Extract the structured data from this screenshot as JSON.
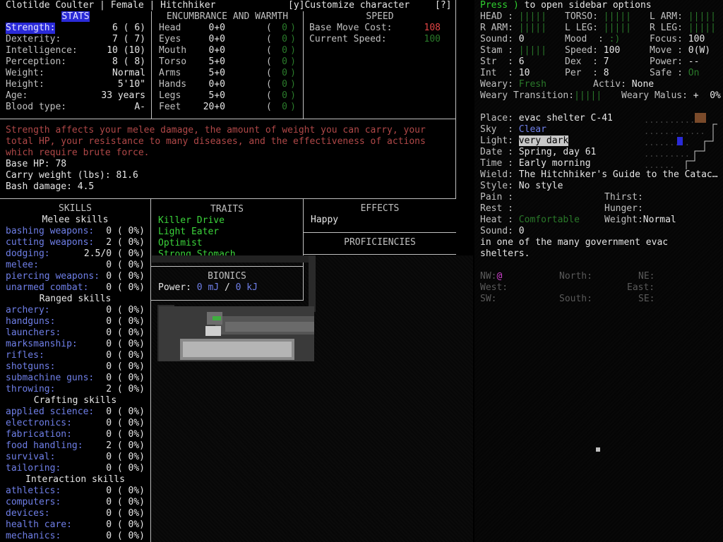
{
  "header": {
    "name_line": "Clotilde Coulter | Female | Hitchhiker",
    "customize": "[y]Customize character",
    "help": "[?]"
  },
  "stats": {
    "title": "STATS",
    "rows": [
      {
        "label": "Strength:",
        "value": "6 ( 6)"
      },
      {
        "label": "Dexterity:",
        "value": "7 ( 7)"
      },
      {
        "label": "Intelligence:",
        "value": "10 (10)"
      },
      {
        "label": "Perception:",
        "value": "8 ( 8)"
      },
      {
        "label": "Weight:",
        "value": "Normal"
      },
      {
        "label": "Height:",
        "value": "5'10\""
      },
      {
        "label": "Age:",
        "value": "33 years"
      },
      {
        "label": "Blood type:",
        "value": "A-"
      }
    ]
  },
  "encumbrance": {
    "title": "ENCUMBRANCE AND WARMTH",
    "rows": [
      {
        "part": "Head",
        "enc": "0+0",
        "warm": "0"
      },
      {
        "part": "Eyes",
        "enc": "0+0",
        "warm": "0"
      },
      {
        "part": "Mouth",
        "enc": "0+0",
        "warm": "0"
      },
      {
        "part": "Torso",
        "enc": "5+0",
        "warm": "0"
      },
      {
        "part": "Arms",
        "enc": "5+0",
        "warm": "0"
      },
      {
        "part": "Hands",
        "enc": "0+0",
        "warm": "0"
      },
      {
        "part": "Legs",
        "enc": "5+0",
        "warm": "0"
      },
      {
        "part": "Feet",
        "enc": "20+0",
        "warm": "0"
      }
    ]
  },
  "speed": {
    "title": "SPEED",
    "move_cost_label": "Base Move Cost:",
    "move_cost": "108",
    "current_label": "Current Speed:",
    "current": "100"
  },
  "description": {
    "text_line1": "Strength affects your melee damage, the amount of weight you can carry, your",
    "text_line2": "total HP, your resistance to many diseases, and the effectiveness of actions",
    "text_line3": "which require brute force.",
    "hp": "Base HP: 78",
    "carry": "Carry weight (lbs): 81.6",
    "bash": "Bash damage: 4.5"
  },
  "skills": {
    "title": "SKILLS",
    "groups": [
      {
        "name": "Melee skills",
        "items": [
          {
            "label": "bashing weapons:",
            "value": "0 ( 0%)"
          },
          {
            "label": "cutting weapons:",
            "value": "2 ( 0%)"
          },
          {
            "label": "dodging:",
            "value": "2.5/0 ( 0%)"
          },
          {
            "label": "melee:",
            "value": "0 ( 0%)"
          },
          {
            "label": "piercing weapons:",
            "value": "0 ( 0%)"
          },
          {
            "label": "unarmed combat:",
            "value": "0 ( 0%)"
          }
        ]
      },
      {
        "name": "Ranged skills",
        "items": [
          {
            "label": "archery:",
            "value": "0 ( 0%)"
          },
          {
            "label": "handguns:",
            "value": "0 ( 0%)"
          },
          {
            "label": "launchers:",
            "value": "0 ( 0%)"
          },
          {
            "label": "marksmanship:",
            "value": "0 ( 0%)"
          },
          {
            "label": "rifles:",
            "value": "0 ( 0%)"
          },
          {
            "label": "shotguns:",
            "value": "0 ( 0%)"
          },
          {
            "label": "submachine guns:",
            "value": "0 ( 0%)"
          },
          {
            "label": "throwing:",
            "value": "2 ( 0%)"
          }
        ]
      },
      {
        "name": "Crafting skills",
        "items": [
          {
            "label": "applied science:",
            "value": "0 ( 0%)"
          },
          {
            "label": "electronics:",
            "value": "0 ( 0%)"
          },
          {
            "label": "fabrication:",
            "value": "0 ( 0%)"
          },
          {
            "label": "food handling:",
            "value": "2 ( 0%)"
          },
          {
            "label": "survival:",
            "value": "0 ( 0%)"
          },
          {
            "label": "tailoring:",
            "value": "0 ( 0%)"
          }
        ]
      },
      {
        "name": "Interaction skills",
        "items": [
          {
            "label": "athletics:",
            "value": "0 ( 0%)"
          },
          {
            "label": "computers:",
            "value": "0 ( 0%)"
          },
          {
            "label": "devices:",
            "value": "0 ( 0%)"
          },
          {
            "label": "health care:",
            "value": "0 ( 0%)"
          },
          {
            "label": "mechanics:",
            "value": "0 ( 0%)"
          }
        ]
      }
    ]
  },
  "traits": {
    "title": "TRAITS",
    "items": [
      "Killer Drive",
      "Light Eater",
      "Optimist",
      "Strong Stomach"
    ]
  },
  "effects": {
    "title": "EFFECTS",
    "items": [
      "Happy"
    ]
  },
  "proficiencies": {
    "title": "PROFICIENCIES"
  },
  "bionics": {
    "title": "BIONICS",
    "power_label": "Power:",
    "power_cur": "0 mJ",
    "sep": "/",
    "power_max": "0 kJ"
  },
  "sidebar": {
    "press": "Press",
    "key": ")",
    "press_rest": " to open sidebar options",
    "body_rows": [
      [
        "HEAD :",
        "|||||",
        "TORSO:",
        "|||||",
        "L ARM:",
        "|||||"
      ],
      [
        "R ARM:",
        "|||||",
        "L LEG:",
        "|||||",
        "R LEG:",
        "|||||"
      ]
    ],
    "sound_label": "Sound: ",
    "sound": "0",
    "mood_label": "Mood  : ",
    "mood": ":)",
    "focus_label": "Focus: ",
    "focus": "100",
    "stam_label": "Stam : ",
    "stam": "|||||",
    "speed_label": "Speed: ",
    "speed": "100",
    "move_label": "Move : ",
    "move": "0(W)",
    "str_label": "Str  : ",
    "str": "6",
    "dex_label": "Dex  : ",
    "dex": "7",
    "power_label": "Power: ",
    "power": "--",
    "int_label": "Int  : ",
    "int": "10",
    "per_label": "Per  : ",
    "per": "8",
    "safe_label": "Safe : ",
    "safe": "On",
    "weary_label": "Weary: ",
    "weary": "Fresh",
    "activ_label": "Activ: ",
    "activ": "None",
    "weary_trans_label": "Weary Transition:",
    "weary_trans": "|||||",
    "weary_malus_label": "Weary Malus: ",
    "weary_malus": "+  0%",
    "place_label": "Place: ",
    "place": "evac shelter C-41",
    "sky_label": "Sky  : ",
    "sky": "Clear",
    "light_label": "Light: ",
    "light": "very dark",
    "date_label": "Date : ",
    "date": "Spring, day 61",
    "time_label": "Time : ",
    "time": "Early morning",
    "wield_label": "Wield: ",
    "wield": "The Hitchhiker's Guide to the Catac…",
    "style_label": "Style: ",
    "style": "No style",
    "pain_label": "Pain :",
    "thirst_label": "Thirst:",
    "rest_label": "Rest :",
    "hunger_label": "Hunger:",
    "heat_label": "Heat : ",
    "heat": "Comfortable",
    "weight_label": "Weight:",
    "weight": "Normal",
    "sound2_label": "Sound: ",
    "sound2": "0",
    "msg_line1": "in one of the many government evac",
    "msg_line2": "shelters.",
    "compass": {
      "nw": "NW:",
      "nw_mark": "@",
      "north": "North:",
      "ne": "NE:",
      "west": "West:",
      "east": "East:",
      "sw": "SW:",
      "south": "South:",
      "se": "SE:"
    }
  },
  "colors": {
    "accent": "#2a2ad8",
    "green": "#2fd12f",
    "red": "#e34545",
    "blue": "#6f7fe8"
  }
}
